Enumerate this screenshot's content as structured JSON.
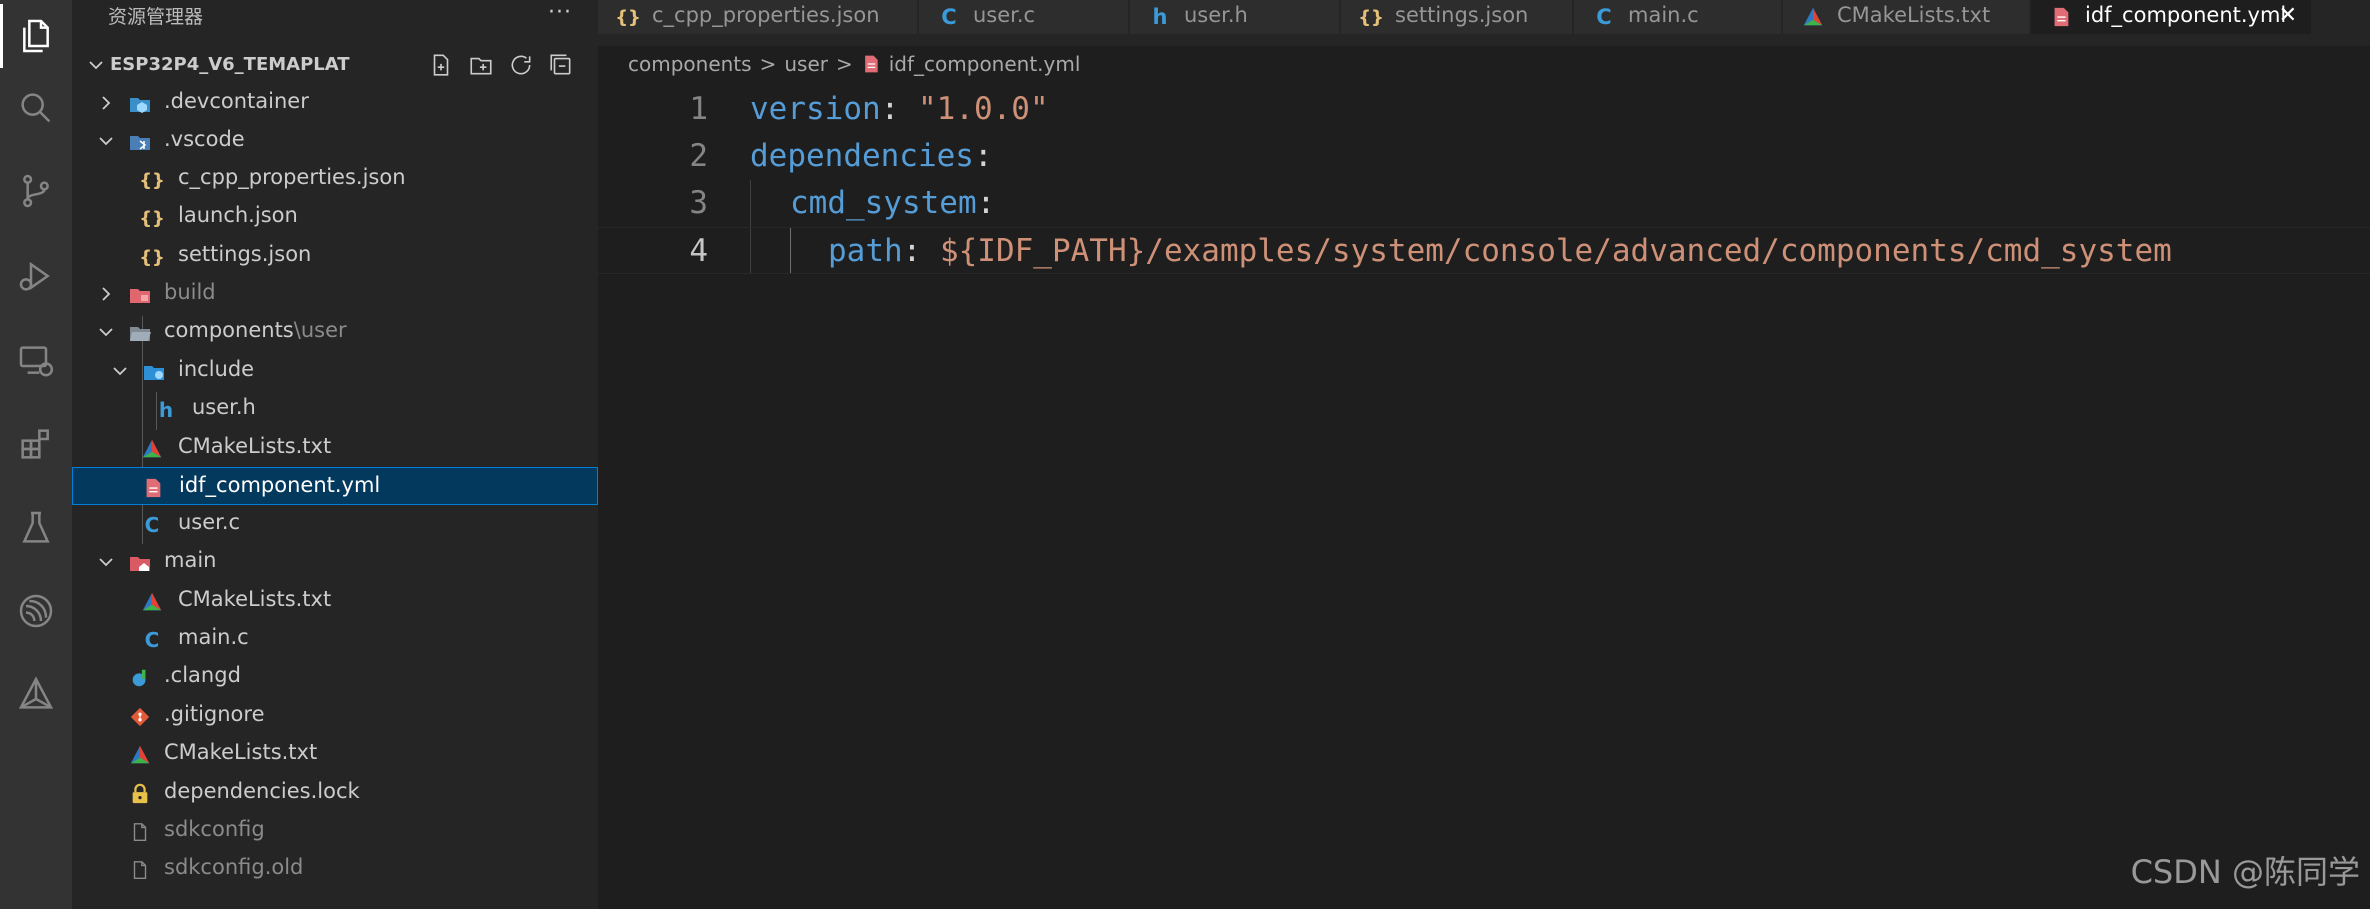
{
  "sidebar": {
    "title": "资源管理器",
    "more": "···",
    "project_name": "ESP32P4_V6_TEMAPLAT",
    "tree": [
      {
        "label": ".devcontainer",
        "icon": "devcontainer-folder-icon"
      },
      {
        "label": ".vscode",
        "icon": "vscode-folder-icon"
      },
      {
        "label": "c_cpp_properties.json",
        "icon": "json-file-icon"
      },
      {
        "label": "launch.json",
        "icon": "json-file-icon"
      },
      {
        "label": "settings.json",
        "icon": "json-file-icon"
      },
      {
        "label": "build",
        "icon": "build-folder-icon"
      },
      {
        "label": "components",
        "icon": "folder-icon"
      },
      {
        "label": "include",
        "icon": "include-folder-icon"
      },
      {
        "label": "user.h",
        "icon": "h-file-icon"
      },
      {
        "label": "CMakeLists.txt",
        "icon": "cmake-file-icon"
      },
      {
        "label": "idf_component.yml",
        "icon": "yml-file-icon"
      },
      {
        "label": "user.c",
        "icon": "c-file-icon"
      },
      {
        "label": "main",
        "icon": "main-folder-icon"
      },
      {
        "label": "CMakeLists.txt",
        "icon": "cmake-file-icon"
      },
      {
        "label": "main.c",
        "icon": "c-file-icon"
      },
      {
        "label": ".clangd",
        "icon": "clangd-file-icon"
      },
      {
        "label": ".gitignore",
        "icon": "git-file-icon"
      },
      {
        "label": "CMakeLists.txt",
        "icon": "cmake-file-icon"
      },
      {
        "label": "dependencies.lock",
        "icon": "lock-file-icon"
      },
      {
        "label": "sdkconfig",
        "icon": "file-icon"
      },
      {
        "label": "sdkconfig.old",
        "icon": "file-icon"
      }
    ],
    "components_suffix": "\\user"
  },
  "tabs": [
    {
      "label": "c_cpp_properties.json",
      "icon": "{}"
    },
    {
      "label": "user.c",
      "icon": "C"
    },
    {
      "label": "user.h",
      "icon": "h"
    },
    {
      "label": "settings.json",
      "icon": "{}"
    },
    {
      "label": "main.c",
      "icon": "C"
    },
    {
      "label": "CMakeLists.txt",
      "icon": "cmake"
    },
    {
      "label": "idf_component.yml",
      "icon": "yml"
    }
  ],
  "breadcrumb": {
    "parts": [
      "components",
      "user",
      "idf_component.yml"
    ],
    "sep": ">"
  },
  "editor": {
    "lines": [
      {
        "num": "1",
        "key": "version",
        "colon": ": ",
        "value": "\"1.0.0\""
      },
      {
        "num": "2",
        "key": "dependencies",
        "colon": ":",
        "value": ""
      },
      {
        "num": "3",
        "key": "cmd_system",
        "colon": ":",
        "value": ""
      },
      {
        "num": "4",
        "key": "path",
        "colon": ": ",
        "value": "${IDF_PATH}/examples/system/console/advanced/components/cmd_system"
      }
    ]
  },
  "watermark": "CSDN @陈同学",
  "colors": {
    "key": "#569cd6",
    "string": "#ce9178",
    "selected_bg": "#04395e",
    "json_icon": "#e5c07b",
    "c_icon": "#3b9bd9",
    "yml_icon": "#e06c75"
  }
}
